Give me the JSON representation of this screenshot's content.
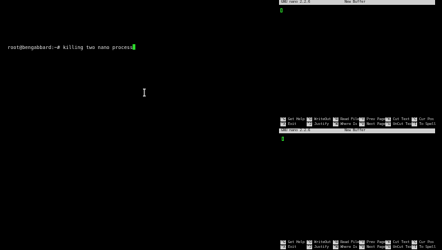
{
  "terminal": {
    "prompt": "root@bengabbard:~#",
    "command": "killing two nano process"
  },
  "nano_top": {
    "version": "GNU nano 2.2.6",
    "buffer": "New Buffer",
    "shortcuts_row1": [
      {
        "key": "^G",
        "label": "Get Help"
      },
      {
        "key": "^O",
        "label": "WriteOut"
      },
      {
        "key": "^R",
        "label": "Read File"
      },
      {
        "key": "^Y",
        "label": "Prev Page"
      },
      {
        "key": "^K",
        "label": "Cut Text"
      },
      {
        "key": "^C",
        "label": "Cur Pos"
      }
    ],
    "shortcuts_row2": [
      {
        "key": "^X",
        "label": "Exit"
      },
      {
        "key": "^J",
        "label": "Justify"
      },
      {
        "key": "^W",
        "label": "Where Is"
      },
      {
        "key": "^V",
        "label": "Next Page"
      },
      {
        "key": "^U",
        "label": "UnCut Text"
      },
      {
        "key": "^T",
        "label": "To Spell"
      }
    ]
  },
  "nano_bottom": {
    "version": "GNU nano 2.2.6",
    "buffer": "New Buffer",
    "shortcuts_row1": [
      {
        "key": "^G",
        "label": "Get Help"
      },
      {
        "key": "^O",
        "label": "WriteOut"
      },
      {
        "key": "^R",
        "label": "Read File"
      },
      {
        "key": "^Y",
        "label": "Prev Page"
      },
      {
        "key": "^K",
        "label": "Cut Text"
      },
      {
        "key": "^C",
        "label": "Cur Pos"
      }
    ],
    "shortcuts_row2": [
      {
        "key": "^X",
        "label": "Exit"
      },
      {
        "key": "^J",
        "label": "Justify"
      },
      {
        "key": "^W",
        "label": "Where Is"
      },
      {
        "key": "^V",
        "label": "Next Page"
      },
      {
        "key": "^U",
        "label": "UnCut Text"
      },
      {
        "key": "^T",
        "label": "To Spell"
      }
    ]
  },
  "colors": {
    "background": "#000000",
    "cursor": "#2bd82b",
    "titlebar": "#cfcfcf"
  },
  "icons": {
    "mouse": "ibeam-cursor-icon"
  }
}
